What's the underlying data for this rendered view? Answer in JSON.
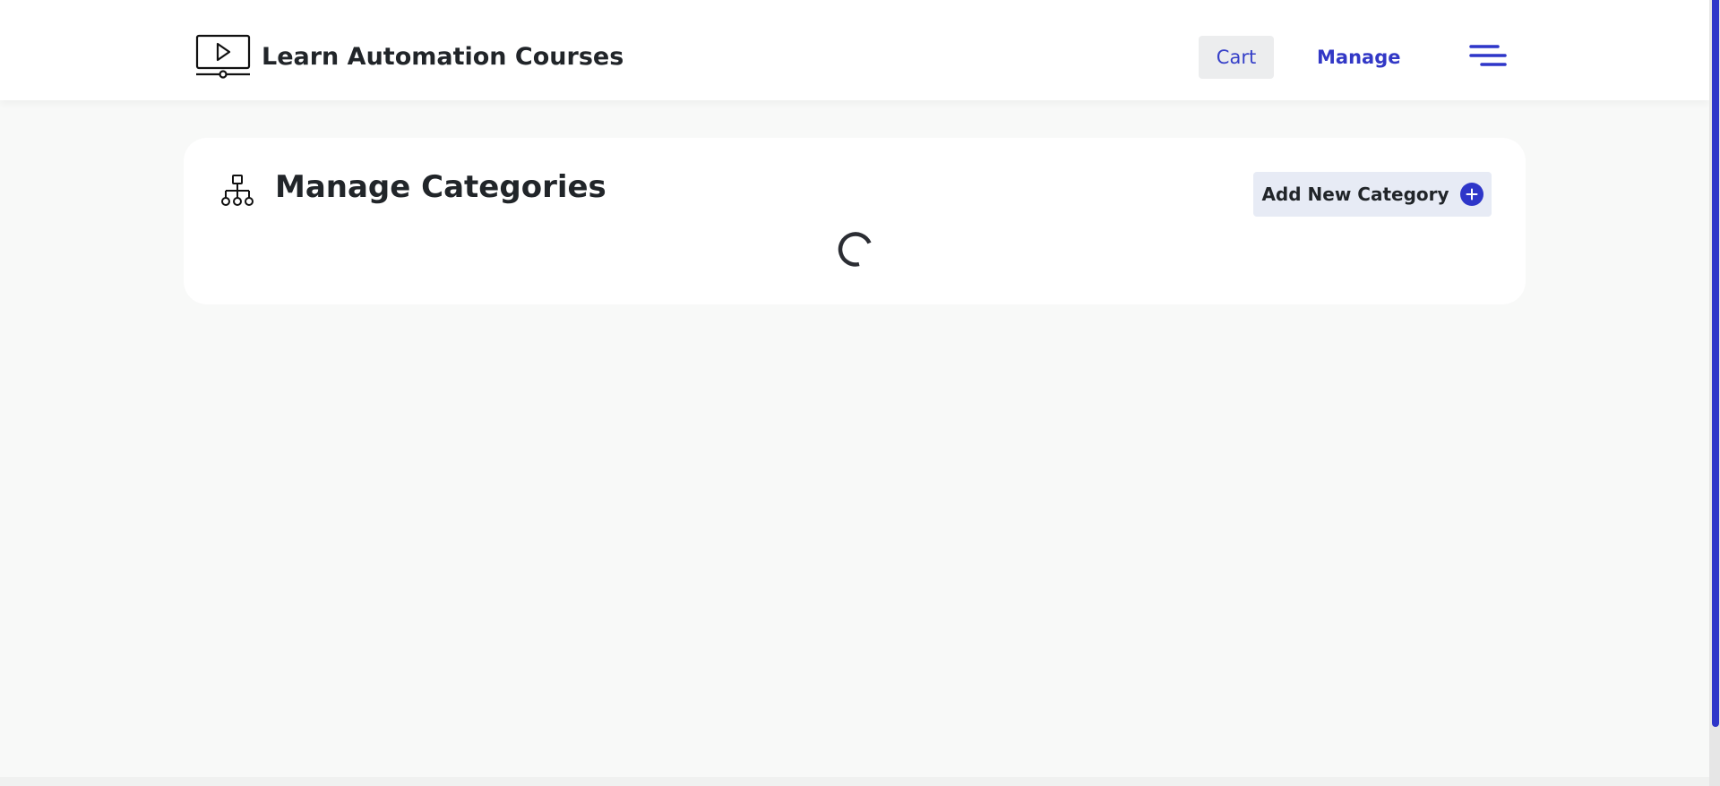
{
  "header": {
    "brand_title": "Learn Automation Courses",
    "brand_icon": "video-course-icon",
    "cart_label": "Cart",
    "manage_label": "Manage",
    "menu_icon": "hamburger-menu-icon"
  },
  "main": {
    "title": "Manage Categories",
    "title_icon": "hierarchy-icon",
    "add_button_label": "Add New Category",
    "add_button_icon": "plus-circle-icon",
    "loading_indicator": "spinner-icon"
  },
  "colors": {
    "accent": "#2e36c9",
    "header_bg": "#ffffff",
    "page_bg": "#f8f9f8",
    "add_button_bg": "#e7ebf5",
    "cart_bg": "#ecedee"
  }
}
